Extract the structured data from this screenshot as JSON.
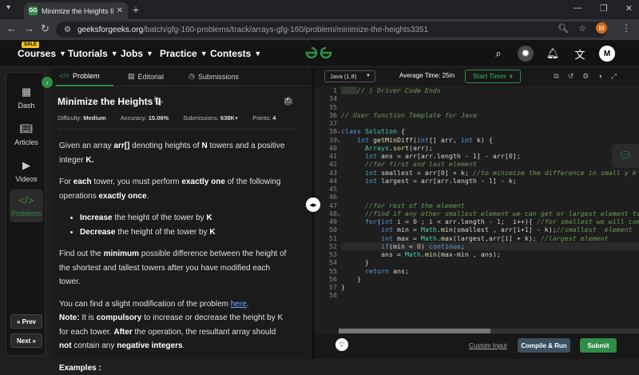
{
  "browser": {
    "tab_title": "Minimize the Heights II | Practice",
    "tab_favicon": "GG",
    "url_host": "geeksforgeeks.org",
    "url_path": "/batch/gfg-160-problems/track/arrays-gfg-160/problem/minimize-the-heights3351",
    "profile_initial": "M"
  },
  "sitenav": {
    "sale_badge": "SALE",
    "items": [
      "Courses",
      "Tutorials",
      "Jobs",
      "Practice",
      "Contests"
    ],
    "avatar": "M",
    "brand_color": "#2f8d46"
  },
  "rail": {
    "items": [
      "Dash",
      "Articles",
      "Videos",
      "Problems"
    ],
    "prev": "« Prev",
    "next": "Next »"
  },
  "panel_tabs": [
    "Problem",
    "Editorial",
    "Submissions"
  ],
  "problem": {
    "title": "Minimize the Heights II",
    "difficulty_label": "Difficulty:",
    "difficulty": "Medium",
    "accuracy_label": "Accuracy:",
    "accuracy": "15.06%",
    "submissions_label": "Submissions:",
    "submissions": "638K+",
    "points_label": "Points:",
    "points": "4",
    "p1_a": "Given an array ",
    "p1_b": "arr[]",
    "p1_c": " denoting heights of ",
    "p1_d": "N",
    "p1_e": " towers and a positive integer ",
    "p1_f": "K.",
    "p2_a": "For ",
    "p2_b": "each",
    "p2_c": " tower, you must perform ",
    "p2_d": "exactly one",
    "p2_e": " of the following operations ",
    "p2_f": "exactly once",
    "p2_g": ".",
    "li1_a": "Increase",
    "li1_b": " the height of the tower by ",
    "li1_c": "K",
    "li2_a": "Decrease",
    "li2_b": " the height of the tower by ",
    "li2_c": "K",
    "p3_a": "Find out the ",
    "p3_b": "minimum",
    "p3_c": " possible difference between the height of the shortest and tallest towers after you have modified each tower.",
    "p4_a": "You can find a slight modification of the problem ",
    "p4_link": "here",
    "p4_b": ".",
    "note_label": "Note:",
    "note_a": " It is ",
    "note_b": "compulsory",
    "note_c": " to increase or decrease the height by K for each tower. ",
    "note_d": "After",
    "note_e": " the operation, the resultant array should ",
    "note_f": "not",
    "note_g": " contain any ",
    "note_h": "negative integers",
    "note_i": ".",
    "examples": "Examples :"
  },
  "editor": {
    "language": "Java (1.8)",
    "avg_time": "Average Time: 25m",
    "start_timer": "Start Timer",
    "line_numbers": [
      "1",
      "34",
      "35",
      "36",
      "37",
      "38",
      "39",
      "40",
      "41",
      "42",
      "43",
      "44",
      "45",
      "46",
      "47",
      "48",
      "49",
      "50",
      "51",
      "52",
      "53",
      "54",
      "55",
      "56",
      "57",
      "58"
    ],
    "custom_input": "Custom Input",
    "compile_run": "Compile & Run",
    "submit": "Submit"
  }
}
